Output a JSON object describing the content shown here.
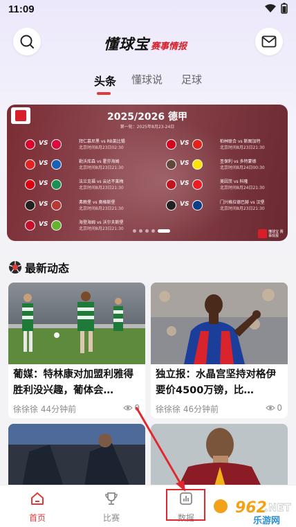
{
  "status": {
    "time": "11:09"
  },
  "header": {
    "logo_main": "懂球宝",
    "logo_sub": "赛事情报"
  },
  "tabs": [
    {
      "label": "头条",
      "active": true
    },
    {
      "label": "懂球说",
      "active": false
    },
    {
      "label": "足球",
      "active": false
    }
  ],
  "banner": {
    "title": "2025/2026 德甲",
    "subtitle": "第一轮：2025年8月23-24日",
    "badge": "懂球宝 赛事情报",
    "fixtures_left": [
      {
        "teams": "拜仁慕尼黑 vs RB莱比锡",
        "time": "北京时间8月23日02:30",
        "home_color": "#dc052d",
        "away_color": "#dd0741"
      },
      {
        "teams": "勒沃库森 vs 霍芬海姆",
        "time": "北京时间8月23日21:30",
        "home_color": "#e32221",
        "away_color": "#1961b5"
      },
      {
        "teams": "法兰克福 vs 云达不莱梅",
        "time": "北京时间8月23日21:30",
        "home_color": "#e1000f",
        "away_color": "#1d9053"
      },
      {
        "teams": "弗赖堡 vs 奥格斯堡",
        "time": "北京时间8月23日21:30",
        "home_color": "#222222",
        "away_color": "#ba3733"
      },
      {
        "teams": "海登海姆 vs 沃尔夫斯堡",
        "time": "北京时间8月23日21:30",
        "home_color": "#c8102e",
        "away_color": "#65b32e"
      }
    ],
    "fixtures_right": [
      {
        "teams": "柏林联合 vs 斯图加特",
        "time": "北京时间8月23日21:30",
        "home_color": "#d4011d",
        "away_color": "#e32219"
      },
      {
        "teams": "圣保利 vs 多特蒙德",
        "time": "北京时间8月24日00:30",
        "home_color": "#624839",
        "away_color": "#fde100"
      },
      {
        "teams": "美因茨 vs 科隆",
        "time": "北京时间8月24日21:30",
        "home_color": "#c3141e",
        "away_color": "#ed1c24"
      },
      {
        "teams": "门兴格拉德巴赫 vs 汉堡",
        "time": "北京时间8月23日21:30",
        "home_color": "#222222",
        "away_color": "#0a3f86"
      }
    ]
  },
  "section": {
    "title": "最新动态"
  },
  "cards": [
    {
      "title": "葡媒：特林康对加盟利雅得胜利没兴趣，葡体会…",
      "author": "徐徐徐",
      "time": "44分钟前",
      "views": "0"
    },
    {
      "title": "独立报：水晶宫坚持对格伊要价4500万镑，比…",
      "author": "徐徐徐",
      "time": "46分钟前",
      "views": "0"
    }
  ],
  "nav": [
    {
      "label": "首页",
      "icon": "home-icon",
      "active": true
    },
    {
      "label": "比赛",
      "icon": "trophy-icon",
      "active": false
    },
    {
      "label": "数据",
      "icon": "chart-icon",
      "active": false
    }
  ],
  "watermark": {
    "number": "962",
    "suffix": ".NET",
    "site": "乐游网"
  },
  "colors": {
    "accent": "#e23a3a",
    "banner_bg": "#7e3a42"
  }
}
